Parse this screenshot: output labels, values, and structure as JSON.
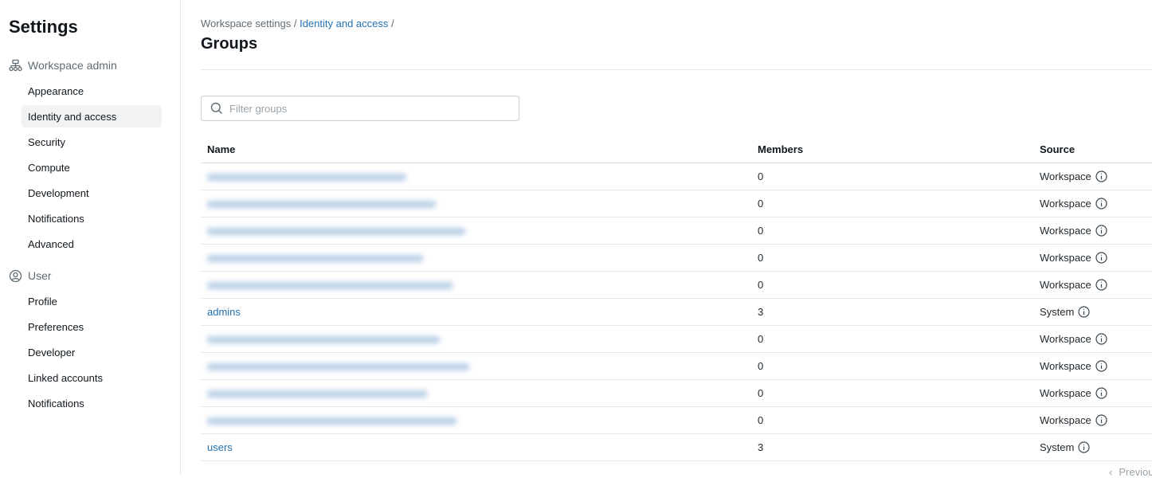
{
  "sidebar": {
    "title": "Settings",
    "sections": [
      {
        "label": "Workspace admin",
        "icon": "workspace-icon",
        "items": [
          "Appearance",
          "Identity and access",
          "Security",
          "Compute",
          "Development",
          "Notifications",
          "Advanced"
        ]
      },
      {
        "label": "User",
        "icon": "user-icon",
        "items": [
          "Profile",
          "Preferences",
          "Developer",
          "Linked accounts",
          "Notifications"
        ]
      }
    ],
    "active_item": "Identity and access"
  },
  "breadcrumb": {
    "items": [
      "Workspace settings",
      "Identity and access"
    ],
    "separator": "/"
  },
  "page_title": "Groups",
  "search": {
    "placeholder": "Filter groups",
    "value": ""
  },
  "table": {
    "headers": {
      "name": "Name",
      "members": "Members",
      "source": "Source"
    },
    "rows": [
      {
        "name": "",
        "members": "0",
        "source": "Workspace",
        "blurred": true
      },
      {
        "name": "",
        "members": "0",
        "source": "Workspace",
        "blurred": true
      },
      {
        "name": "",
        "members": "0",
        "source": "Workspace",
        "blurred": true
      },
      {
        "name": "",
        "members": "0",
        "source": "Workspace",
        "blurred": true
      },
      {
        "name": "",
        "members": "0",
        "source": "Workspace",
        "blurred": true
      },
      {
        "name": "admins",
        "members": "3",
        "source": "System",
        "blurred": false
      },
      {
        "name": "",
        "members": "0",
        "source": "Workspace",
        "blurred": true
      },
      {
        "name": "",
        "members": "0",
        "source": "Workspace",
        "blurred": true
      },
      {
        "name": "",
        "members": "0",
        "source": "Workspace",
        "blurred": true
      },
      {
        "name": "",
        "members": "0",
        "source": "Workspace",
        "blurred": true
      },
      {
        "name": "users",
        "members": "3",
        "source": "System",
        "blurred": false
      }
    ]
  },
  "pagination": {
    "previous_label": "Previous"
  },
  "colors": {
    "link": "#2272b4",
    "active_bg": "#f1f2f4",
    "border": "#e4e6e8"
  }
}
